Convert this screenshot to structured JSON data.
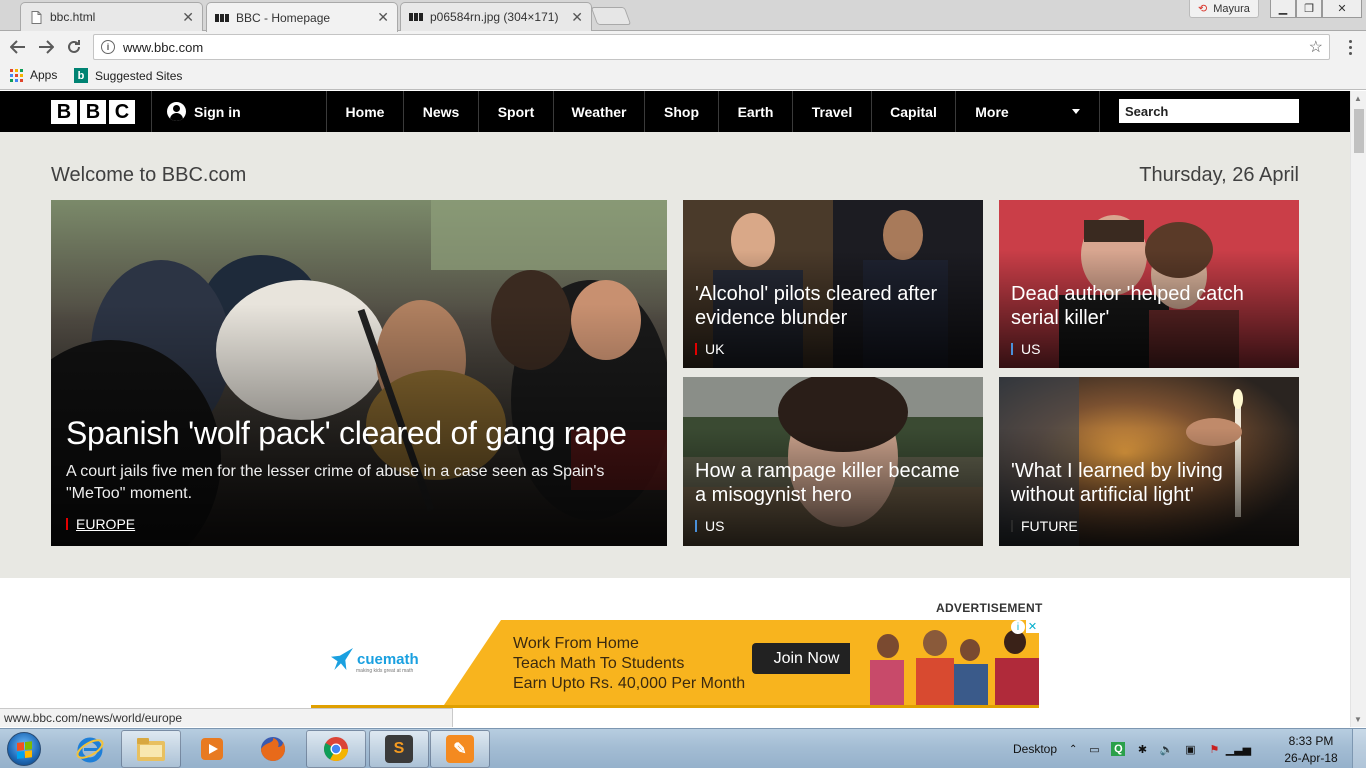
{
  "browser": {
    "tabs": [
      {
        "title": "bbc.html",
        "active": false
      },
      {
        "title": "BBC - Homepage",
        "active": true
      },
      {
        "title": "p06584rn.jpg (304×171)",
        "active": false
      }
    ],
    "profile_name": "Mayura",
    "url": "www.bbc.com",
    "bookmarks": [
      {
        "label": "Apps",
        "icon": "apps-grid-icon"
      },
      {
        "label": "Suggested Sites",
        "icon": "bing-icon"
      }
    ],
    "status_url": "www.bbc.com/news/world/europe"
  },
  "bbc": {
    "logo_letters": [
      "B",
      "B",
      "C"
    ],
    "signin_label": "Sign in",
    "nav": [
      "Home",
      "News",
      "Sport",
      "Weather",
      "Shop",
      "Earth",
      "Travel",
      "Capital",
      "More"
    ],
    "search_placeholder": "Search",
    "welcome": "Welcome to BBC.com",
    "date": "Thursday, 26 April",
    "main_story": {
      "headline": "Spanish 'wolf pack' cleared of gang rape",
      "summary": "A court jails five men for the lesser crime of abuse in a case seen as Spain's \"MeToo\" moment.",
      "tag": "EUROPE",
      "tag_color": "#e30000"
    },
    "stories": [
      {
        "headline": "'Alcohol' pilots cleared after evidence blunder",
        "tag": "UK",
        "tag_color": "#e30000"
      },
      {
        "headline": "Dead author 'helped catch serial killer'",
        "tag": "US",
        "tag_color": "#4a90d9"
      },
      {
        "headline": "How a rampage killer became a misogynist hero",
        "tag": "US",
        "tag_color": "#4a90d9"
      },
      {
        "headline": "'What I learned by living without artificial light'",
        "tag": "FUTURE",
        "tag_color": "#2a2a2a"
      }
    ],
    "ad": {
      "label": "ADVERTISEMENT",
      "brand": "cuemath",
      "brand_tagline": "making kids great at math",
      "lines": [
        "Work From Home",
        "Teach Math To Students",
        "Earn Upto Rs. 40,000 Per Month"
      ],
      "button": "Join Now"
    }
  },
  "taskbar": {
    "apps": [
      "internet-explorer-icon",
      "file-explorer-icon",
      "media-player-icon",
      "firefox-icon",
      "chrome-icon",
      "sublime-text-icon",
      "paint-icon"
    ],
    "desktop_label": "Desktop",
    "time": "8:33 PM",
    "date": "26-Apr-18"
  }
}
